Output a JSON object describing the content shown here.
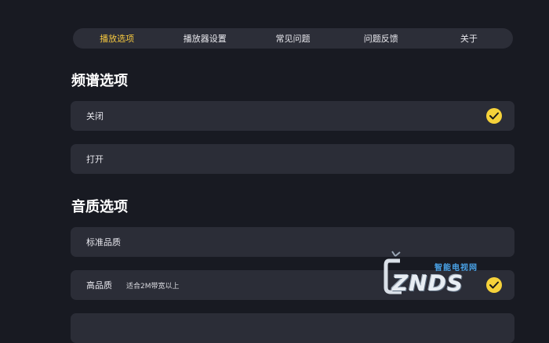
{
  "tabs": [
    {
      "label": "播放选项",
      "active": true
    },
    {
      "label": "播放器设置",
      "active": false
    },
    {
      "label": "常见问题",
      "active": false
    },
    {
      "label": "问题反馈",
      "active": false
    },
    {
      "label": "关于",
      "active": false
    }
  ],
  "spectrum": {
    "title": "频谱选项",
    "options": [
      {
        "label": "关闭",
        "selected": true
      },
      {
        "label": "打开",
        "selected": false
      }
    ]
  },
  "quality": {
    "title": "音质选项",
    "options": [
      {
        "label": "标准品质",
        "selected": false
      },
      {
        "label": "高品质",
        "note": "适合2M带宽以上",
        "selected": true
      }
    ]
  },
  "watermark": {
    "cn": "智能电视网",
    "logo": "ZNDS"
  },
  "colors": {
    "background": "#181a22",
    "accent": "#f3c63f",
    "check": "#f6d23a",
    "card": "#2b2d37"
  },
  "icons": {
    "check": "checkmark-circle-icon"
  }
}
